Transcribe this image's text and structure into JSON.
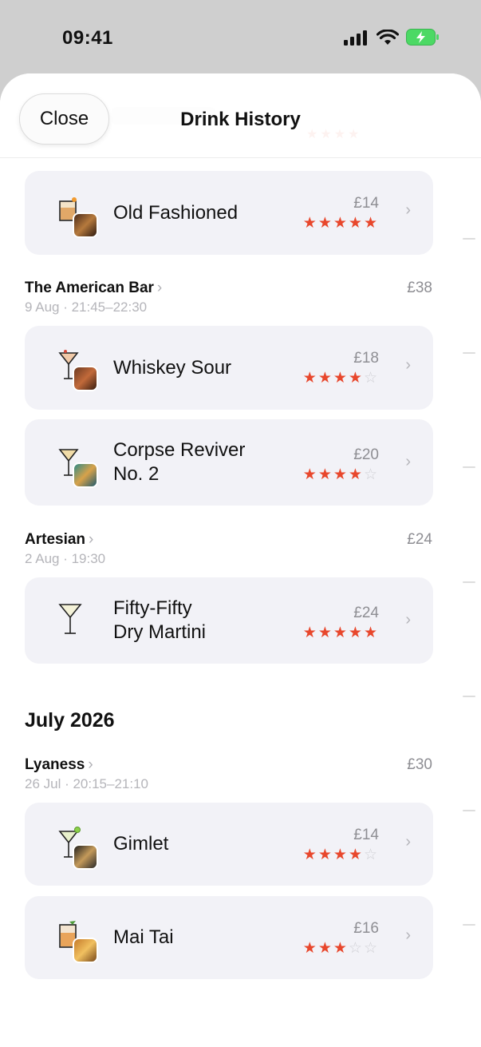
{
  "status": {
    "time": "09:41"
  },
  "header": {
    "close_label": "Close",
    "title": "Drink History"
  },
  "sections": {
    "top_card": {
      "name": "Old Fashioned",
      "price": "£14",
      "rating": 5
    },
    "venue1": {
      "name": "The American Bar",
      "chev": "›",
      "sub": "9 Aug · 21:45–22:30",
      "total": "£38"
    },
    "venue1_drinks": [
      {
        "name": "Whiskey Sour",
        "price": "£18",
        "rating": 4
      },
      {
        "name_line1": "Corpse Reviver",
        "name_line2": "No. 2",
        "price": "£20",
        "rating": 4
      }
    ],
    "venue2": {
      "name": "Artesian",
      "chev": "›",
      "sub": "2 Aug · 19:30",
      "total": "£24"
    },
    "venue2_drinks": [
      {
        "name_line1": "Fifty-Fifty",
        "name_line2": "Dry Martini",
        "price": "£24",
        "rating": 5
      }
    ],
    "month": "July 2026",
    "venue3": {
      "name": "Lyaness",
      "chev": "›",
      "sub": "26 Jul · 20:15–21:10",
      "total": "£30"
    },
    "venue3_drinks": [
      {
        "name": "Gimlet",
        "price": "£14",
        "rating": 4
      },
      {
        "name": "Mai Tai",
        "price": "£16",
        "rating": 3
      }
    ]
  },
  "icons": {
    "battery": "battery-charging-icon",
    "wifi": "wifi-icon",
    "signal": "cellular-signal-icon",
    "chevron": "chevron-right-icon"
  },
  "colors": {
    "star": "#e8472c",
    "battery": "#4cd964",
    "card": "#f2f2f7"
  }
}
